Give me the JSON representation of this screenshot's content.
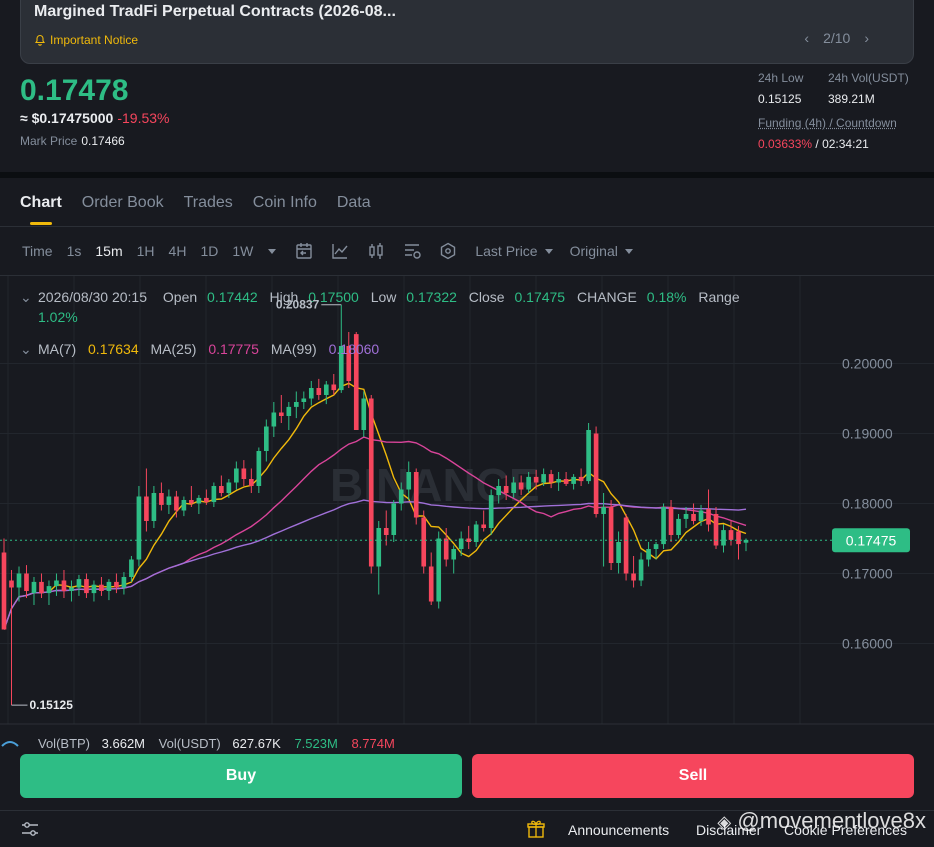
{
  "notice": {
    "title": "Margined TradFi Perpetual Contracts (2026-08...",
    "tag": "Important Notice",
    "pager": "2/10"
  },
  "price": {
    "last": "0.17478",
    "usd": "≈ $0.17475000",
    "change": "-19.53%",
    "mark_label": "Mark Price",
    "mark_value": "0.17466"
  },
  "stats": {
    "low_label": "24h Low",
    "low_value": "0.15125",
    "vol_label": "24h Vol(USDT)",
    "vol_value": "389.21M",
    "funding_label": "Funding (4h) / Countdown",
    "funding_rate": "0.03633%",
    "funding_sep": "/",
    "countdown": "02:34:21"
  },
  "tabs": [
    "Chart",
    "Order Book",
    "Trades",
    "Coin Info",
    "Data"
  ],
  "toolbar": {
    "time_label": "Time",
    "intervals": [
      "1s",
      "15m",
      "1H",
      "4H",
      "1D",
      "1W"
    ],
    "selected_interval": "15m",
    "price_type": "Last Price",
    "view": "Original"
  },
  "ohlc": {
    "date": "2026/08/30 20:15",
    "open_label": "Open",
    "open": "0.17442",
    "high_label": "High",
    "high": "0.17500",
    "low_label": "Low",
    "low": "0.17322",
    "close_label": "Close",
    "close": "0.17475",
    "change_label": "CHANGE",
    "change": "0.18%",
    "range_label": "Range",
    "range": "1.02%"
  },
  "ma": {
    "ma7_label": "MA(7)",
    "ma7": "0.17634",
    "ma25_label": "MA(25)",
    "ma25": "0.17775",
    "ma99_label": "MA(99)",
    "ma99": "0.18060"
  },
  "volume_line": {
    "vol_btp_label": "Vol(BTP)",
    "vol_btp": "3.662M",
    "vol_usdt_label": "Vol(USDT)",
    "vol_usdt": "627.67K",
    "v1": "7.523M",
    "v2": "8.774M"
  },
  "chart_data": {
    "type": "candlestick",
    "y_ticks": [
      "0.20000",
      "0.19000",
      "0.18000",
      "0.17000",
      "0.16000"
    ],
    "ylim": [
      0.1485,
      0.2125
    ],
    "current_price": "0.17475",
    "high_marker": "0.20837",
    "low_marker": "0.15125",
    "watermark": "BINANCE",
    "candles": [
      {
        "o": 0.173,
        "h": 0.175,
        "l": 0.162,
        "c": 0.162
      },
      {
        "o": 0.169,
        "h": 0.1705,
        "l": 0.1512,
        "c": 0.168
      },
      {
        "o": 0.168,
        "h": 0.171,
        "l": 0.166,
        "c": 0.17
      },
      {
        "o": 0.17,
        "h": 0.1712,
        "l": 0.1665,
        "c": 0.1675
      },
      {
        "o": 0.1672,
        "h": 0.1695,
        "l": 0.1655,
        "c": 0.1688
      },
      {
        "o": 0.1688,
        "h": 0.17,
        "l": 0.1665,
        "c": 0.1672
      },
      {
        "o": 0.1672,
        "h": 0.169,
        "l": 0.1655,
        "c": 0.1682
      },
      {
        "o": 0.1682,
        "h": 0.17,
        "l": 0.1668,
        "c": 0.169
      },
      {
        "o": 0.169,
        "h": 0.1705,
        "l": 0.1665,
        "c": 0.1675
      },
      {
        "o": 0.1675,
        "h": 0.169,
        "l": 0.166,
        "c": 0.168
      },
      {
        "o": 0.168,
        "h": 0.1698,
        "l": 0.1668,
        "c": 0.1692
      },
      {
        "o": 0.1692,
        "h": 0.17,
        "l": 0.1665,
        "c": 0.1672
      },
      {
        "o": 0.1672,
        "h": 0.169,
        "l": 0.166,
        "c": 0.1684
      },
      {
        "o": 0.1684,
        "h": 0.1695,
        "l": 0.1668,
        "c": 0.1675
      },
      {
        "o": 0.1675,
        "h": 0.1692,
        "l": 0.1662,
        "c": 0.1688
      },
      {
        "o": 0.1688,
        "h": 0.17,
        "l": 0.1672,
        "c": 0.168
      },
      {
        "o": 0.168,
        "h": 0.1702,
        "l": 0.167,
        "c": 0.1695
      },
      {
        "o": 0.1695,
        "h": 0.1725,
        "l": 0.1688,
        "c": 0.172
      },
      {
        "o": 0.172,
        "h": 0.1825,
        "l": 0.171,
        "c": 0.181
      },
      {
        "o": 0.181,
        "h": 0.185,
        "l": 0.176,
        "c": 0.1775
      },
      {
        "o": 0.1775,
        "h": 0.1825,
        "l": 0.1765,
        "c": 0.1815
      },
      {
        "o": 0.1815,
        "h": 0.183,
        "l": 0.179,
        "c": 0.1798
      },
      {
        "o": 0.1798,
        "h": 0.182,
        "l": 0.1785,
        "c": 0.181
      },
      {
        "o": 0.181,
        "h": 0.1818,
        "l": 0.178,
        "c": 0.179
      },
      {
        "o": 0.179,
        "h": 0.181,
        "l": 0.1782,
        "c": 0.1805
      },
      {
        "o": 0.1805,
        "h": 0.1825,
        "l": 0.1795,
        "c": 0.18
      },
      {
        "o": 0.18,
        "h": 0.1812,
        "l": 0.1785,
        "c": 0.1808
      },
      {
        "o": 0.1808,
        "h": 0.182,
        "l": 0.1798,
        "c": 0.1802
      },
      {
        "o": 0.1802,
        "h": 0.183,
        "l": 0.1795,
        "c": 0.1825
      },
      {
        "o": 0.1825,
        "h": 0.184,
        "l": 0.181,
        "c": 0.1815
      },
      {
        "o": 0.1815,
        "h": 0.1835,
        "l": 0.1808,
        "c": 0.183
      },
      {
        "o": 0.183,
        "h": 0.186,
        "l": 0.182,
        "c": 0.185
      },
      {
        "o": 0.185,
        "h": 0.1862,
        "l": 0.1825,
        "c": 0.1835
      },
      {
        "o": 0.1835,
        "h": 0.185,
        "l": 0.1815,
        "c": 0.1825
      },
      {
        "o": 0.1825,
        "h": 0.188,
        "l": 0.1815,
        "c": 0.1875
      },
      {
        "o": 0.1875,
        "h": 0.192,
        "l": 0.186,
        "c": 0.191
      },
      {
        "o": 0.191,
        "h": 0.1945,
        "l": 0.1895,
        "c": 0.193
      },
      {
        "o": 0.193,
        "h": 0.1955,
        "l": 0.1915,
        "c": 0.1925
      },
      {
        "o": 0.1925,
        "h": 0.1945,
        "l": 0.1905,
        "c": 0.1938
      },
      {
        "o": 0.1938,
        "h": 0.196,
        "l": 0.1922,
        "c": 0.1945
      },
      {
        "o": 0.1945,
        "h": 0.196,
        "l": 0.1935,
        "c": 0.195
      },
      {
        "o": 0.195,
        "h": 0.1975,
        "l": 0.194,
        "c": 0.1965
      },
      {
        "o": 0.1965,
        "h": 0.1978,
        "l": 0.1948,
        "c": 0.1955
      },
      {
        "o": 0.1955,
        "h": 0.1975,
        "l": 0.1942,
        "c": 0.197
      },
      {
        "o": 0.197,
        "h": 0.1985,
        "l": 0.1955,
        "c": 0.1962
      },
      {
        "o": 0.1962,
        "h": 0.2084,
        "l": 0.1958,
        "c": 0.2025
      },
      {
        "o": 0.2025,
        "h": 0.2045,
        "l": 0.1965,
        "c": 0.1975
      },
      {
        "o": 0.2042,
        "h": 0.2045,
        "l": 0.1905,
        "c": 0.1905
      },
      {
        "o": 0.1905,
        "h": 0.196,
        "l": 0.1895,
        "c": 0.195
      },
      {
        "o": 0.195,
        "h": 0.1955,
        "l": 0.17,
        "c": 0.171
      },
      {
        "o": 0.171,
        "h": 0.1775,
        "l": 0.167,
        "c": 0.1765
      },
      {
        "o": 0.1765,
        "h": 0.179,
        "l": 0.174,
        "c": 0.1755
      },
      {
        "o": 0.1755,
        "h": 0.1805,
        "l": 0.1745,
        "c": 0.18
      },
      {
        "o": 0.18,
        "h": 0.183,
        "l": 0.179,
        "c": 0.182
      },
      {
        "o": 0.182,
        "h": 0.186,
        "l": 0.1805,
        "c": 0.1845
      },
      {
        "o": 0.1845,
        "h": 0.185,
        "l": 0.177,
        "c": 0.178
      },
      {
        "o": 0.178,
        "h": 0.179,
        "l": 0.17,
        "c": 0.171
      },
      {
        "o": 0.171,
        "h": 0.173,
        "l": 0.1655,
        "c": 0.166
      },
      {
        "o": 0.166,
        "h": 0.176,
        "l": 0.165,
        "c": 0.175
      },
      {
        "o": 0.175,
        "h": 0.1765,
        "l": 0.171,
        "c": 0.172
      },
      {
        "o": 0.172,
        "h": 0.174,
        "l": 0.17,
        "c": 0.1735
      },
      {
        "o": 0.1735,
        "h": 0.176,
        "l": 0.1725,
        "c": 0.175
      },
      {
        "o": 0.175,
        "h": 0.1768,
        "l": 0.1735,
        "c": 0.1745
      },
      {
        "o": 0.1745,
        "h": 0.1775,
        "l": 0.1738,
        "c": 0.177
      },
      {
        "o": 0.177,
        "h": 0.179,
        "l": 0.176,
        "c": 0.1765
      },
      {
        "o": 0.1765,
        "h": 0.182,
        "l": 0.1755,
        "c": 0.1812
      },
      {
        "o": 0.1812,
        "h": 0.1835,
        "l": 0.18,
        "c": 0.1825
      },
      {
        "o": 0.1825,
        "h": 0.184,
        "l": 0.1805,
        "c": 0.1815
      },
      {
        "o": 0.1815,
        "h": 0.1838,
        "l": 0.1808,
        "c": 0.183
      },
      {
        "o": 0.183,
        "h": 0.184,
        "l": 0.1812,
        "c": 0.182
      },
      {
        "o": 0.182,
        "h": 0.1845,
        "l": 0.1815,
        "c": 0.1838
      },
      {
        "o": 0.1838,
        "h": 0.1848,
        "l": 0.182,
        "c": 0.183
      },
      {
        "o": 0.183,
        "h": 0.185,
        "l": 0.1825,
        "c": 0.1842
      },
      {
        "o": 0.1842,
        "h": 0.1848,
        "l": 0.1822,
        "c": 0.183
      },
      {
        "o": 0.183,
        "h": 0.1845,
        "l": 0.1818,
        "c": 0.1835
      },
      {
        "o": 0.1835,
        "h": 0.1845,
        "l": 0.1825,
        "c": 0.1828
      },
      {
        "o": 0.1828,
        "h": 0.1842,
        "l": 0.182,
        "c": 0.1838
      },
      {
        "o": 0.1838,
        "h": 0.185,
        "l": 0.1825,
        "c": 0.1832
      },
      {
        "o": 0.1832,
        "h": 0.1915,
        "l": 0.1828,
        "c": 0.1905
      },
      {
        "o": 0.19,
        "h": 0.191,
        "l": 0.178,
        "c": 0.1785
      },
      {
        "o": 0.1785,
        "h": 0.1815,
        "l": 0.171,
        "c": 0.1795
      },
      {
        "o": 0.1795,
        "h": 0.1805,
        "l": 0.1705,
        "c": 0.1715
      },
      {
        "o": 0.1715,
        "h": 0.176,
        "l": 0.17,
        "c": 0.1745
      },
      {
        "o": 0.178,
        "h": 0.1785,
        "l": 0.169,
        "c": 0.17
      },
      {
        "o": 0.17,
        "h": 0.1725,
        "l": 0.168,
        "c": 0.169
      },
      {
        "o": 0.169,
        "h": 0.173,
        "l": 0.1682,
        "c": 0.172
      },
      {
        "o": 0.172,
        "h": 0.1745,
        "l": 0.171,
        "c": 0.1735
      },
      {
        "o": 0.1735,
        "h": 0.1745,
        "l": 0.172,
        "c": 0.1742
      },
      {
        "o": 0.1742,
        "h": 0.18,
        "l": 0.1735,
        "c": 0.1795
      },
      {
        "o": 0.1795,
        "h": 0.1805,
        "l": 0.1745,
        "c": 0.1755
      },
      {
        "o": 0.1755,
        "h": 0.1785,
        "l": 0.175,
        "c": 0.1778
      },
      {
        "o": 0.1778,
        "h": 0.1795,
        "l": 0.1765,
        "c": 0.1785
      },
      {
        "o": 0.1785,
        "h": 0.18,
        "l": 0.177,
        "c": 0.1775
      },
      {
        "o": 0.1775,
        "h": 0.1798,
        "l": 0.1768,
        "c": 0.179
      },
      {
        "o": 0.1792,
        "h": 0.182,
        "l": 0.176,
        "c": 0.177
      },
      {
        "o": 0.1785,
        "h": 0.1795,
        "l": 0.1735,
        "c": 0.174
      },
      {
        "o": 0.174,
        "h": 0.177,
        "l": 0.173,
        "c": 0.1762
      },
      {
        "o": 0.1762,
        "h": 0.1775,
        "l": 0.174,
        "c": 0.1748
      },
      {
        "o": 0.176,
        "h": 0.1768,
        "l": 0.172,
        "c": 0.1742
      },
      {
        "o": 0.1744,
        "h": 0.175,
        "l": 0.1732,
        "c": 0.1748
      }
    ]
  },
  "buttons": {
    "buy": "Buy",
    "sell": "Sell"
  },
  "footer": {
    "announcements": "Announcements",
    "disclaimer": "Disclaimer",
    "cookie": "Cookie Preferences",
    "watermark": "@movementlove8x"
  },
  "colors": {
    "up": "#2ebd85",
    "down": "#f6465d",
    "ma7": "#f0b90b",
    "ma25": "#d9449a",
    "ma99": "#a070d8",
    "accent": "#f0b90b"
  }
}
